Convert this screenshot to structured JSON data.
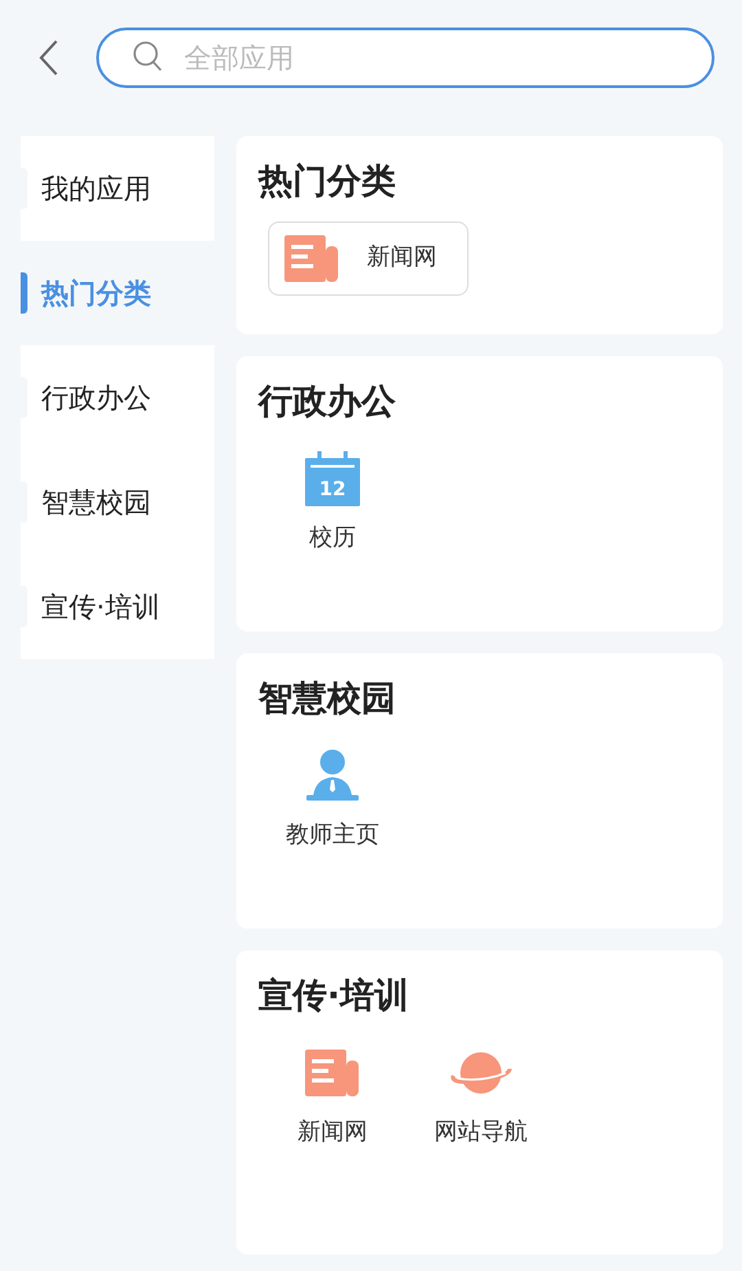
{
  "search": {
    "placeholder": "全部应用"
  },
  "sidebar": {
    "items": [
      {
        "label": "我的应用",
        "selected": false
      },
      {
        "label": "热门分类",
        "selected": true
      },
      {
        "label": "行政办公",
        "selected": false
      },
      {
        "label": "智慧校园",
        "selected": false
      },
      {
        "label": "宣传·培训",
        "selected": false
      }
    ]
  },
  "sections": [
    {
      "title": "热门分类",
      "apps": [
        {
          "kind": "news",
          "label": "新闻网"
        }
      ]
    },
    {
      "title": "行政办公",
      "apps": [
        {
          "kind": "calendar",
          "icon_text": "12",
          "label": "校历"
        }
      ]
    },
    {
      "title": "智慧校园",
      "apps": [
        {
          "kind": "person",
          "label": "教师主页"
        }
      ]
    },
    {
      "title": "宣传·培训",
      "apps": [
        {
          "kind": "news",
          "label": "新闻网"
        },
        {
          "kind": "planet",
          "label": "网站导航"
        }
      ]
    }
  ]
}
